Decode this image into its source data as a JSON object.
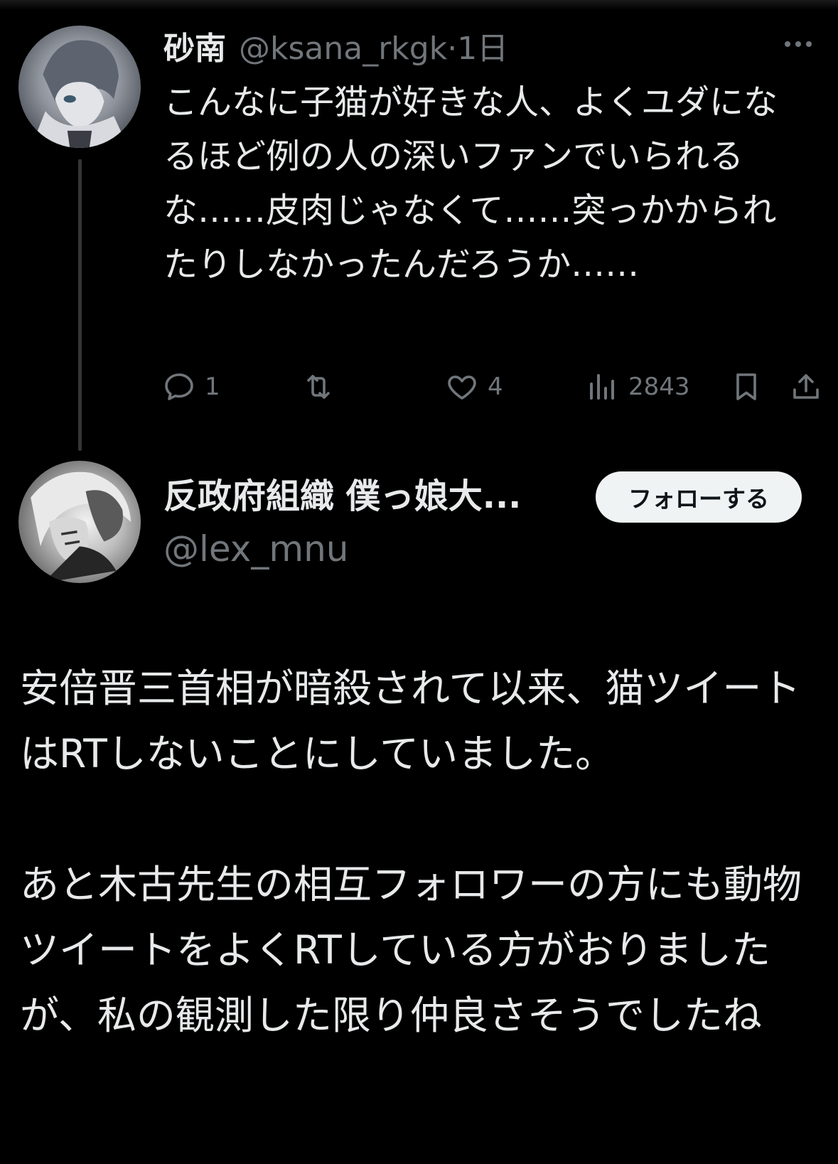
{
  "parent_tweet": {
    "display_name": "砂南",
    "handle": "@ksana_rkgk",
    "time": "·1日",
    "text": "こんなに子猫が好きな人、よくユダになるほど例の人の深いファンでいられるな……皮肉じゃなくて……突っかかられたりしなかったんだろうか……",
    "avatar_icon": "user-avatar-anime-character",
    "more_icon": "more-options-icon",
    "actions": {
      "reply_icon": "reply-icon",
      "reply_count": "1",
      "retweet_icon": "retweet-icon",
      "retweet_count": "",
      "like_icon": "heart-icon",
      "like_count": "4",
      "views_icon": "views-icon",
      "views_count": "2843",
      "bookmark_icon": "bookmark-icon",
      "share_icon": "share-icon"
    }
  },
  "reply_tweet": {
    "display_name": "反政府組織 僕っ娘大...",
    "handle": "@lex_mnu",
    "follow_label": "フォローする",
    "avatar_icon": "user-avatar-monochrome-illustration",
    "text": "安倍晋三首相が暗殺されて以来、猫ツイートはRTしないことにしていました。\n\nあと木古先生の相互フォロワーの方にも動物ツイートをよくRTしている方がおりましたが、私の観測した限り仲良さそうでしたね"
  },
  "colors": {
    "background": "#000000",
    "primary_text": "#e7e9ea",
    "secondary_text": "#71767b",
    "thread_line": "#333639",
    "follow_button_bg": "#eff3f4",
    "follow_button_text": "#0f1419"
  }
}
